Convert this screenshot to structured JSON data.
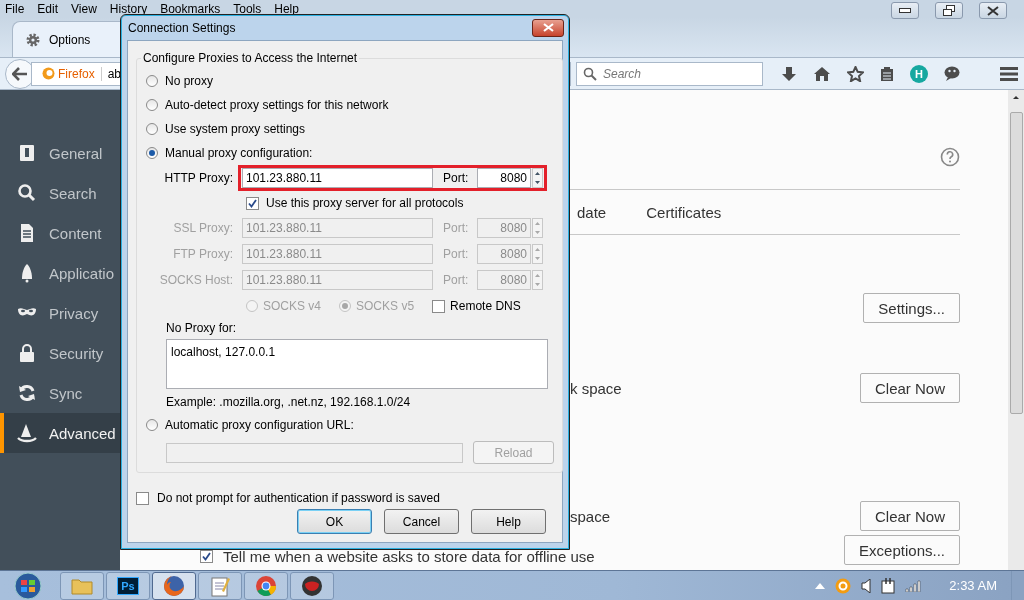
{
  "menu_bar": [
    "File",
    "Edit",
    "View",
    "History",
    "Bookmarks",
    "Tools",
    "Help"
  ],
  "tab": {
    "title": "Options"
  },
  "nav_bar": {
    "identity": "Firefox",
    "url": "ab",
    "search_placeholder": "Search",
    "account_initial": "H"
  },
  "sidebar": {
    "items": [
      {
        "kind": "general",
        "label": "General",
        "selected": false
      },
      {
        "kind": "search",
        "label": "Search",
        "selected": false
      },
      {
        "kind": "content",
        "label": "Content",
        "selected": false
      },
      {
        "kind": "applications",
        "label": "Applicatio",
        "selected": false
      },
      {
        "kind": "privacy",
        "label": "Privacy",
        "selected": false
      },
      {
        "kind": "security",
        "label": "Security",
        "selected": false
      },
      {
        "kind": "sync",
        "label": "Sync",
        "selected": false
      },
      {
        "kind": "advanced",
        "label": "Advanced",
        "selected": true
      }
    ]
  },
  "content": {
    "tabs": [
      "date",
      "Certificates"
    ],
    "rows": [
      {
        "kind": "button",
        "button": "Settings..."
      },
      {
        "kind": "text",
        "text": "k space",
        "button": "Clear Now"
      },
      {
        "kind": "text",
        "text": "space",
        "button": "Clear Now"
      },
      {
        "kind": "checkbox",
        "text": "Tell me when a website asks to store data for offline use",
        "checked": true,
        "button": "Exceptions..."
      }
    ]
  },
  "dialog": {
    "title": "Connection Settings",
    "group_title": "Configure Proxies to Access the Internet",
    "modes": [
      {
        "label": "No proxy",
        "selected": false
      },
      {
        "label": "Auto-detect proxy settings for this network",
        "selected": false
      },
      {
        "label": "Use system proxy settings",
        "selected": false
      },
      {
        "label": "Manual proxy configuration:",
        "selected": true
      }
    ],
    "proxies": [
      {
        "label": "HTTP Proxy:",
        "value": "101.23.880.11",
        "port_label": "Port:",
        "port": "8080",
        "disabled": false,
        "highlighted": true
      },
      {
        "label": "SSL Proxy:",
        "value": "101.23.880.11",
        "port_label": "Port:",
        "port": "8080",
        "disabled": true,
        "highlighted": false
      },
      {
        "label": "FTP Proxy:",
        "value": "101.23.880.11",
        "port_label": "Port:",
        "port": "8080",
        "disabled": true,
        "highlighted": false
      },
      {
        "label": "SOCKS Host:",
        "value": "101.23.880.11",
        "port_label": "Port:",
        "port": "8080",
        "disabled": true,
        "highlighted": false
      }
    ],
    "share_all": {
      "label": "Use this proxy server for all protocols",
      "checked": true
    },
    "socks_versions": [
      {
        "label": "SOCKS v4",
        "selected": false,
        "disabled": true
      },
      {
        "label": "SOCKS v5",
        "selected": true,
        "disabled": true
      }
    ],
    "remote_dns": {
      "label": "Remote DNS",
      "checked": false
    },
    "no_proxy": {
      "label": "No Proxy for:",
      "value": "localhost, 127.0.0.1",
      "example": "Example: .mozilla.org, .net.nz, 192.168.1.0/24"
    },
    "auto_url": {
      "label": "Automatic proxy configuration URL:",
      "selected": false,
      "button": "Reload",
      "disabled": true
    },
    "no_prompt": {
      "label": "Do not prompt for authentication if password is saved",
      "checked": false
    },
    "buttons": [
      {
        "label": "OK",
        "default": true
      },
      {
        "label": "Cancel",
        "default": false
      },
      {
        "label": "Help",
        "default": false
      }
    ]
  },
  "taskbar": {
    "apps": [
      {
        "kind": "folder",
        "selected": false
      },
      {
        "kind": "ps",
        "label": "Ps",
        "selected": false
      },
      {
        "kind": "firefox",
        "selected": true
      },
      {
        "kind": "notepad",
        "selected": false
      },
      {
        "kind": "chrome",
        "selected": false
      },
      {
        "kind": "ball",
        "selected": false
      }
    ],
    "clock": "2:33 AM"
  }
}
